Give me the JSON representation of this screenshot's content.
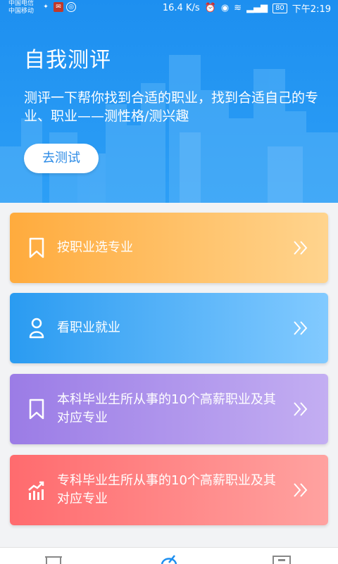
{
  "status_bar": {
    "carrier_1": "中国电信",
    "carrier_2": "中国移动",
    "speed": "16.4 K/s",
    "battery": "80",
    "time": "下午2:19"
  },
  "header": {
    "title": "自我测评",
    "description": "测评一下帮你找到合适的职业，找到合适自己的专业、职业——测性格/测兴趣",
    "button_label": "去测试"
  },
  "cards": [
    {
      "label": "按职业选专业",
      "icon": "bookmark-icon",
      "color_start": "#ffab3d",
      "color_end": "#ffd48e"
    },
    {
      "label": "看职业就业",
      "icon": "person-icon",
      "color_start": "#2a9bf1",
      "color_end": "#82caff"
    },
    {
      "label": "本科毕业生所从事的10个高薪职业及其对应专业",
      "icon": "bookmark-icon",
      "color_start": "#9b7ce6",
      "color_end": "#c3aef2"
    },
    {
      "label": "专科毕业生所从事的10个高薪职业及其对应专业",
      "icon": "chart-growth-icon",
      "color_start": "#ff6b6e",
      "color_end": "#ffa2a0"
    }
  ],
  "tab_bar": {
    "icons": [
      "home-icon",
      "assessment-icon",
      "profile-icon"
    ]
  }
}
